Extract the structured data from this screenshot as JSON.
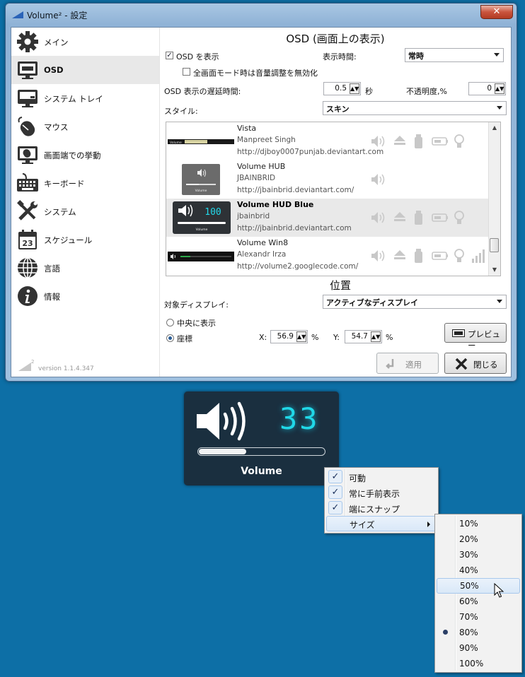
{
  "window": {
    "title": "Volume² - 設定",
    "close_glyph": "✕"
  },
  "sidebar": {
    "items": [
      {
        "label": "メイン",
        "icon": "gear-icon"
      },
      {
        "label": "OSD",
        "icon": "monitor-icon",
        "active": true
      },
      {
        "label": "システム トレイ",
        "icon": "tray-icon"
      },
      {
        "label": "マウス",
        "icon": "mouse-icon"
      },
      {
        "label": "画面端での挙動",
        "icon": "screen-edge-icon"
      },
      {
        "label": "キーボード",
        "icon": "keyboard-icon"
      },
      {
        "label": "システム",
        "icon": "tools-icon"
      },
      {
        "label": "スケジュール",
        "icon": "calendar-icon",
        "day": "23"
      },
      {
        "label": "言語",
        "icon": "globe-icon"
      },
      {
        "label": "情報",
        "icon": "info-icon"
      }
    ],
    "version": "version 1.1.4.347",
    "version_logo_sup": "2"
  },
  "osd_section": {
    "title": "OSD (画面上の表示)",
    "show_osd": {
      "label": "OSD を表示",
      "checked": true
    },
    "fullscreen_disable": {
      "label": "全画面モード時は音量調整を無効化",
      "checked": false
    },
    "display_time": {
      "label": "表示時間:",
      "value": "常時"
    },
    "delay": {
      "label": "OSD 表示の遅延時間:",
      "value": "0.5",
      "unit": "秒"
    },
    "opacity": {
      "label": "不透明度,%",
      "value": "0"
    },
    "style": {
      "label": "スタイル:",
      "value": "スキン"
    },
    "skins": [
      {
        "name": "Vista",
        "author": "Manpreet Singh",
        "url": "http://djboy0007punjab.deviantart.com",
        "thumb": "vista",
        "thumb_text": "Volume",
        "features": [
          "speaker",
          "eject",
          "usb",
          "battery",
          "bulb"
        ]
      },
      {
        "name": "Volume HUB",
        "author": "JBAINBRID",
        "url": "http://jbainbrid.deviantart.com/",
        "thumb": "hub",
        "thumb_text": "Volume",
        "features": [
          "speaker"
        ]
      },
      {
        "name": "Volume HUD Blue",
        "author": "jbainbrid",
        "url": "http://jbainbrid.deviantart.com",
        "thumb": "hudblue",
        "thumb_text": "Volume",
        "thumb_digits": "100",
        "selected": true,
        "features": [
          "speaker",
          "eject",
          "usb",
          "battery",
          "bulb"
        ]
      },
      {
        "name": "Volume Win8",
        "author": "Alexandr Irza",
        "url": "http://volume2.googlecode.com/",
        "thumb": "win8",
        "features": [
          "speaker",
          "eject",
          "usb",
          "battery",
          "bulb",
          "bars"
        ]
      }
    ]
  },
  "position_section": {
    "title": "位置",
    "target_display": {
      "label": "対象ディスプレイ:",
      "value": "アクティブなディスプレイ"
    },
    "center": {
      "label": "中央に表示",
      "selected": false
    },
    "coords": {
      "label": "座標",
      "selected": true
    },
    "x": {
      "label": "X:",
      "value": "56.9",
      "unit": "%"
    },
    "y": {
      "label": "Y:",
      "value": "54.7",
      "unit": "%"
    },
    "preview_button": "プレビュー"
  },
  "buttons": {
    "apply": "適用",
    "close": "閉じる"
  },
  "osd_overlay": {
    "digits": "33",
    "label": "Volume",
    "level_percent": 33
  },
  "context_menu": {
    "items": [
      {
        "label": "可動",
        "checked": true
      },
      {
        "label": "常に手前表示",
        "checked": true
      },
      {
        "label": "端にスナップ",
        "checked": true
      },
      {
        "label": "サイズ",
        "submenu": true,
        "highlighted": true
      }
    ]
  },
  "size_menu": {
    "options": [
      "10%",
      "20%",
      "30%",
      "40%",
      "50%",
      "60%",
      "70%",
      "80%",
      "90%",
      "100%"
    ],
    "selected": "80%",
    "hovered": "50%"
  }
}
